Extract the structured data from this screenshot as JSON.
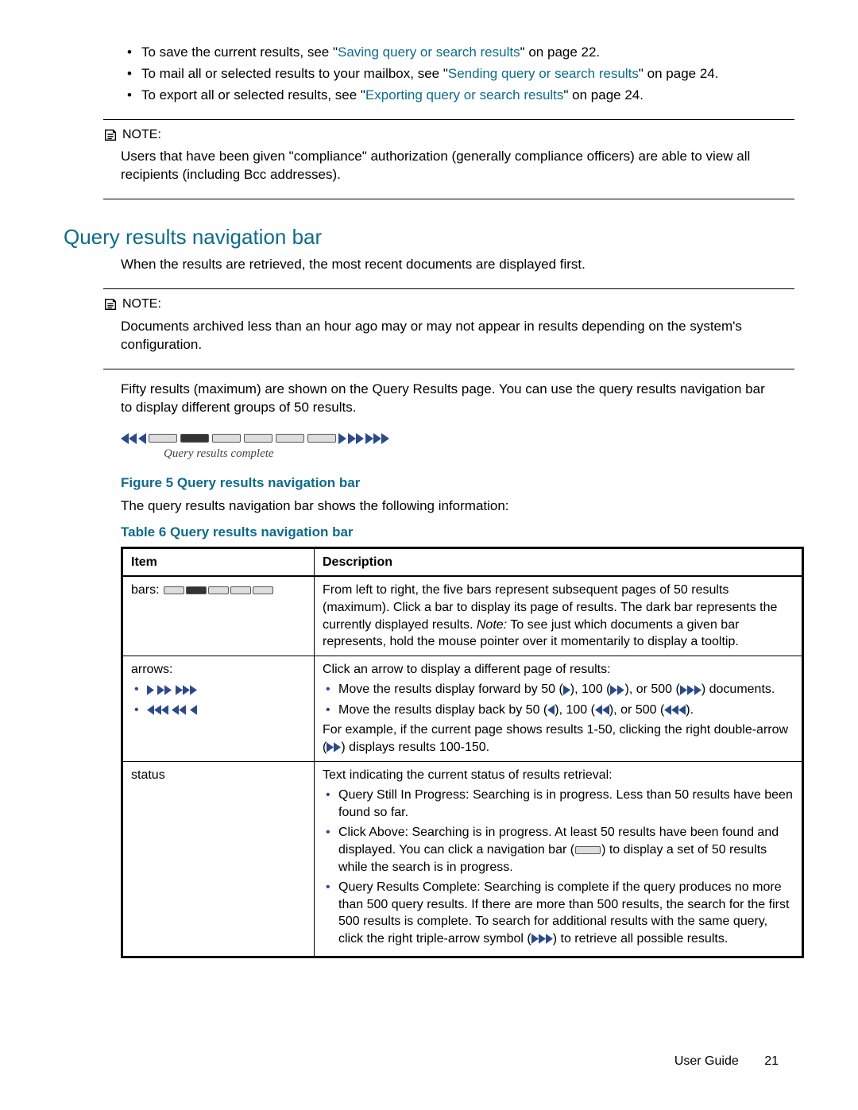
{
  "bullets_top": [
    {
      "pre": "To save the current results, see \"",
      "link": "Saving query or search results",
      "post": "\" on page 22."
    },
    {
      "pre": "To mail all or selected results to your mailbox, see \"",
      "link": "Sending query or search results",
      "post": "\" on page 24."
    },
    {
      "pre": "To export all or selected results, see \"",
      "link": "Exporting query or search results",
      "post": "\" on page 24."
    }
  ],
  "note_label": "NOTE:",
  "note1_text": "Users that have been given \"compliance\" authorization (generally compliance officers) are able to view all recipients (including Bcc addresses).",
  "section_heading": "Query results navigation bar",
  "section_intro": "When the results are retrieved, the most recent documents are displayed first.",
  "note2_text": "Documents archived less than an hour ago may or may not appear in results depending on the system's configuration.",
  "para_after_note2": "Fifty results (maximum) are shown on the Query Results page. You can use the query results navigation bar to display different groups of 50 results.",
  "nav_status": "Query results complete",
  "fig_caption": "Figure 5 Query results navigation bar",
  "fig_followup": "The query results navigation bar shows the following information:",
  "tbl_caption": "Table 6 Query results navigation bar",
  "table_headers": {
    "item": "Item",
    "desc": "Description"
  },
  "row_bars": {
    "label": "bars:",
    "desc_p1": "From left to right, the five bars represent subsequent pages of 50 results (maximum). Click a bar to display its page of results. The dark bar represents the currently displayed results. ",
    "note_label": "Note:",
    "desc_p2": " To see just which documents a given bar represents, hold the mouse pointer over it momentarily to display a tooltip."
  },
  "row_arrows": {
    "label": "arrows:",
    "lead": "Click an arrow to display a different page of results:",
    "fwd_a": "Move the results display forward by 50 (",
    "fwd_b": "), 100 (",
    "fwd_c": "), or 500 (",
    "fwd_d": ") documents.",
    "back_a": "Move the results display back by 50 (",
    "back_b": "), 100 (",
    "back_c": "), or 500 (",
    "back_d": ").",
    "example_a": "For example, if the current page shows results 1-50, clicking the right double-arrow (",
    "example_b": ") displays results 100-150."
  },
  "row_status": {
    "label": "status",
    "lead": "Text indicating the current status of results retrieval:",
    "s1": "Query Still In Progress:  Searching is in progress.  Less than 50 results have been found so far.",
    "s2a": "Click Above:  Searching is in progress.  At least 50 results have been found and displayed.  You can click a navigation bar (",
    "s2b": ") to display a set of 50 results while the search is in progress.",
    "s3a": "Query Results Complete:  Searching is complete if the query produces no more than 500 query results. If there are more than 500 results, the search for the first 500 results is complete.  To search for additional results with the same query, click the right triple-arrow symbol (",
    "s3b": ") to retrieve all possible results."
  },
  "footer": {
    "label": "User Guide",
    "page": "21"
  }
}
